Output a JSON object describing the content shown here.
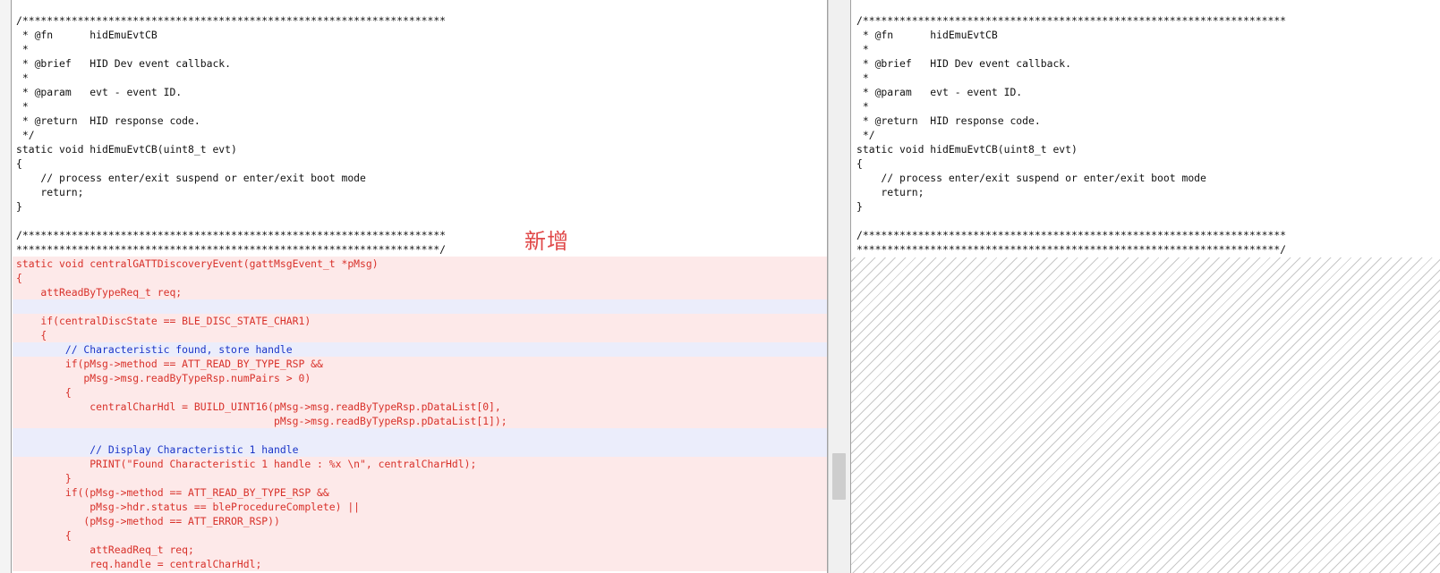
{
  "annotation": "新增",
  "colors": {
    "added_bg": "#fde9e9",
    "added_text": "#d8312a",
    "comment_text": "#1a35c8",
    "highlight_bg": "#ebedfb",
    "annotation": "#e04848"
  },
  "scroll": {
    "thumb_fraction_from_top": 0.86
  },
  "left_lines": [
    {
      "text": "/*********************************************************************",
      "type": "normal"
    },
    {
      "text": " * @fn      hidEmuEvtCB",
      "type": "normal"
    },
    {
      "text": " *",
      "type": "normal"
    },
    {
      "text": " * @brief   HID Dev event callback.",
      "type": "normal"
    },
    {
      "text": " *",
      "type": "normal"
    },
    {
      "text": " * @param   evt - event ID.",
      "type": "normal"
    },
    {
      "text": " *",
      "type": "normal"
    },
    {
      "text": " * @return  HID response code.",
      "type": "normal"
    },
    {
      "text": " */",
      "type": "normal"
    },
    {
      "text": "static void hidEmuEvtCB(uint8_t evt)",
      "type": "normal"
    },
    {
      "text": "{",
      "type": "normal"
    },
    {
      "text": "    // process enter/exit suspend or enter/exit boot mode",
      "type": "normal"
    },
    {
      "text": "    return;",
      "type": "normal"
    },
    {
      "text": "}",
      "type": "normal"
    },
    {
      "text": "",
      "type": "normal"
    },
    {
      "text": "/*********************************************************************",
      "type": "normal"
    },
    {
      "text": "*********************************************************************/",
      "type": "normal"
    },
    {
      "text": "static void centralGATTDiscoveryEvent(gattMsgEvent_t *pMsg)",
      "type": "added"
    },
    {
      "text": "{",
      "type": "added"
    },
    {
      "text": "    attReadByTypeReq_t req;",
      "type": "added"
    },
    {
      "text": "",
      "type": "added-hl"
    },
    {
      "text": "    if(centralDiscState == BLE_DISC_STATE_CHAR1)",
      "type": "added"
    },
    {
      "text": "    {",
      "type": "added"
    },
    {
      "text": "        // Characteristic found, store handle",
      "type": "added-comment-hl"
    },
    {
      "text": "        if(pMsg->method == ATT_READ_BY_TYPE_RSP &&",
      "type": "added"
    },
    {
      "text": "           pMsg->msg.readByTypeRsp.numPairs > 0)",
      "type": "added"
    },
    {
      "text": "        {",
      "type": "added"
    },
    {
      "text": "            centralCharHdl = BUILD_UINT16(pMsg->msg.readByTypeRsp.pDataList[0],",
      "type": "added"
    },
    {
      "text": "                                          pMsg->msg.readByTypeRsp.pDataList[1]);",
      "type": "added"
    },
    {
      "text": "",
      "type": "added-hl"
    },
    {
      "text": "            // Display Characteristic 1 handle",
      "type": "added-comment-hl"
    },
    {
      "text": "            PRINT(\"Found Characteristic 1 handle : %x \\n\", centralCharHdl);",
      "type": "added"
    },
    {
      "text": "        }",
      "type": "added"
    },
    {
      "text": "        if((pMsg->method == ATT_READ_BY_TYPE_RSP &&",
      "type": "added"
    },
    {
      "text": "            pMsg->hdr.status == bleProcedureComplete) ||",
      "type": "added"
    },
    {
      "text": "           (pMsg->method == ATT_ERROR_RSP))",
      "type": "added"
    },
    {
      "text": "        {",
      "type": "added"
    },
    {
      "text": "            attReadReq_t req;",
      "type": "added"
    },
    {
      "text": "            req.handle = centralCharHdl;",
      "type": "added"
    }
  ],
  "right_lines": [
    {
      "text": "/*********************************************************************"
    },
    {
      "text": " * @fn      hidEmuEvtCB"
    },
    {
      "text": " *"
    },
    {
      "text": " * @brief   HID Dev event callback."
    },
    {
      "text": " *"
    },
    {
      "text": " * @param   evt - event ID."
    },
    {
      "text": " *"
    },
    {
      "text": " * @return  HID response code."
    },
    {
      "text": " */"
    },
    {
      "text": "static void hidEmuEvtCB(uint8_t evt)"
    },
    {
      "text": "{"
    },
    {
      "text": "    // process enter/exit suspend or enter/exit boot mode"
    },
    {
      "text": "    return;"
    },
    {
      "text": "}"
    },
    {
      "text": ""
    },
    {
      "text": "/*********************************************************************"
    },
    {
      "text": "*********************************************************************/"
    }
  ]
}
